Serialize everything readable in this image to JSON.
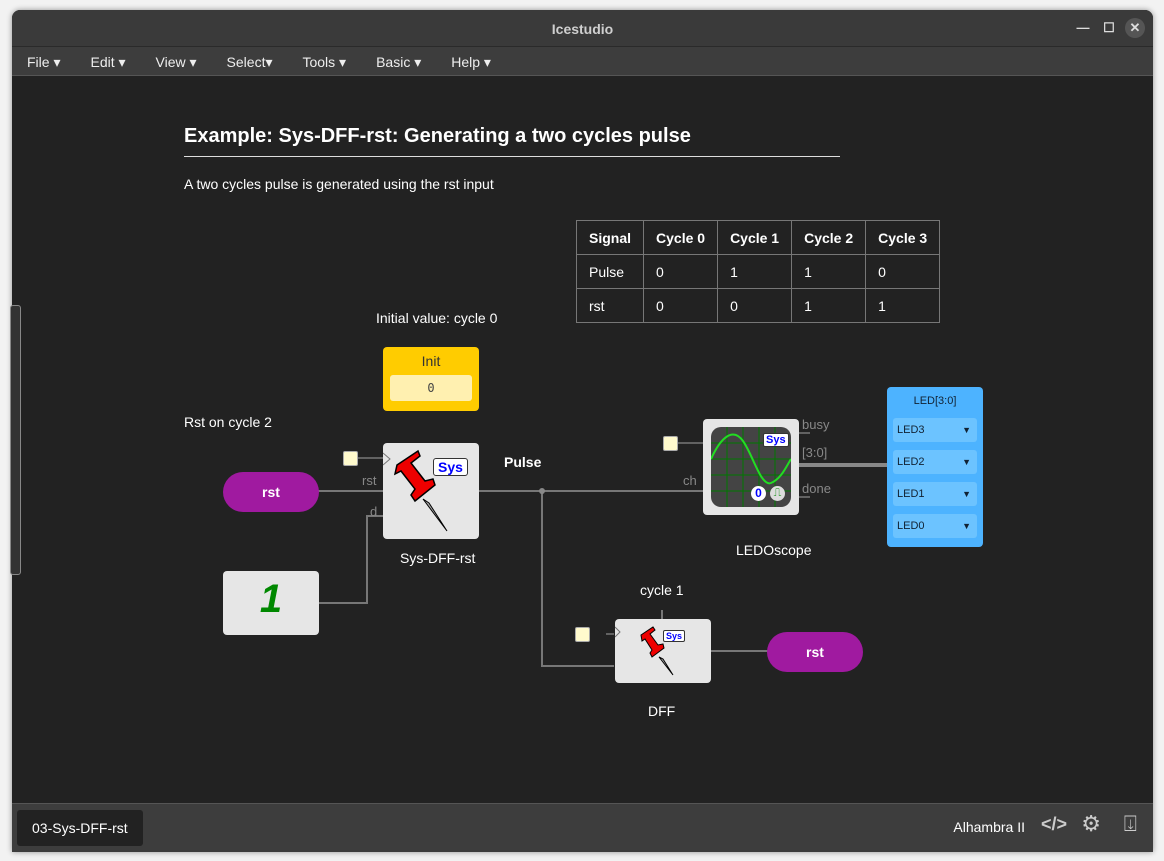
{
  "window": {
    "title": "Icestudio"
  },
  "menu": [
    "File ▾",
    "Edit ▾",
    "View ▾",
    "Select▾",
    "Tools ▾",
    "Basic ▾",
    "Help ▾"
  ],
  "doc": {
    "heading": "Example: Sys-DFF-rst: Generating a two cycles pulse",
    "subtitle": "A two cycles pulse is generated using the rst input"
  },
  "table": {
    "headers": [
      "Signal",
      "Cycle 0",
      "Cycle 1",
      "Cycle 2",
      "Cycle 3"
    ],
    "rows": [
      [
        "Pulse",
        "0",
        "1",
        "1",
        "0"
      ],
      [
        "rst",
        "0",
        "0",
        "1",
        "1"
      ]
    ]
  },
  "notes": {
    "initial": "Initial value: cycle 0",
    "rst_cycle": "Rst on cycle 2",
    "cycle1": "cycle 1"
  },
  "blocks": {
    "init": {
      "label": "Init",
      "value": "0"
    },
    "sysdff": {
      "name": "Sys-DFF-rst",
      "badge": "Sys",
      "port_rst": "rst",
      "port_d": "d"
    },
    "pulse_label": "Pulse",
    "rst_in": "rst",
    "rst_out": "rst",
    "const": "1",
    "ledoscope": {
      "name": "LEDOscope",
      "badge": "Sys",
      "port_ch": "ch",
      "port_busy": "busy",
      "port_bus": "[3:0]",
      "port_done": "done",
      "num": "0"
    },
    "leds": {
      "title": "LED[3:0]",
      "items": [
        "LED3",
        "LED2",
        "LED1",
        "LED0"
      ]
    },
    "dff": {
      "name": "DFF",
      "badge": "Sys"
    }
  },
  "footer": {
    "tab": "03-Sys-DFF-rst",
    "board": "Alhambra II"
  },
  "colors": {
    "pill": "#a01aa0",
    "init": "#ffcc00",
    "led": "#4db3ff"
  }
}
